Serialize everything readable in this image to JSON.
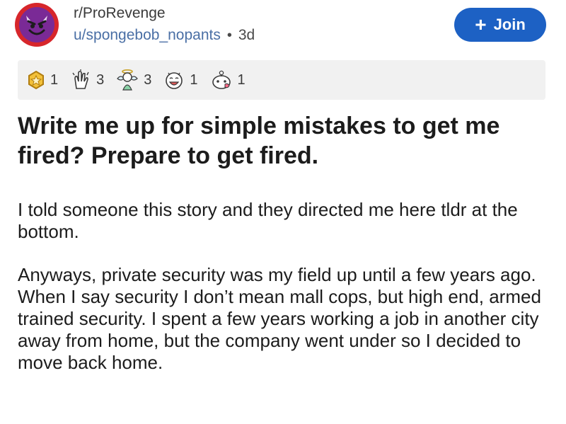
{
  "post": {
    "subreddit": "r/ProRevenge",
    "author": "u/spongebob_nopants",
    "separator": "•",
    "age": "3d",
    "join_label": "Join",
    "join_icon": "+",
    "title": "Write me up for simple mistakes to get me fired? Prepare to get fired.",
    "paragraphs": [
      "I told someone this story and they directed me here tldr at the bottom.",
      "Anyways, private security was my field up until a few years ago. When I say security I don’t mean mall cops, but high end, armed trained security. I spent a few years working a job in another city away from home, but the company went under so I decided to move back home."
    ]
  },
  "awards": [
    {
      "icon": "gold-medal-icon",
      "count": "1"
    },
    {
      "icon": "praise-hands-icon",
      "count": "3"
    },
    {
      "icon": "angel-icon",
      "count": "3"
    },
    {
      "icon": "laughing-face-icon",
      "count": "1"
    },
    {
      "icon": "wholesome-icon",
      "count": "1"
    }
  ],
  "colors": {
    "accent": "#1d61c4",
    "avatar_ring": "#d7262b",
    "avatar_face": "#7a2a96",
    "award_bar": "#f1f1f1",
    "username": "#4a6fa5"
  }
}
